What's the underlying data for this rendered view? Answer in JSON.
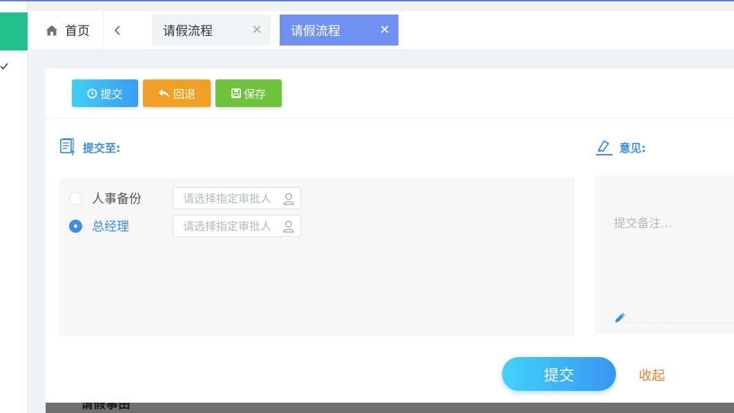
{
  "colors": {
    "accent": "#3a8ee6",
    "brand_green": "#22c08a",
    "active_tab": "#6f91ef",
    "btn_back": "#f0a126",
    "btn_save": "#6dc33c",
    "collapse_text": "#e8802f"
  },
  "tabs_bar": {
    "home_label": "首页",
    "tabs": [
      {
        "label": "请假流程",
        "active": false
      },
      {
        "label": "请假流程",
        "active": true
      }
    ]
  },
  "toolbar": {
    "submit_label": "提交",
    "back_label": "回退",
    "save_label": "保存"
  },
  "submit_to": {
    "title": "提交至:",
    "options": [
      {
        "label": "人事备份",
        "checked": false,
        "placeholder": "请选择指定审批人"
      },
      {
        "label": "总经理",
        "checked": true,
        "placeholder": "请选择指定审批人"
      }
    ]
  },
  "opinion": {
    "title": "意见:",
    "placeholder": "提交备注..."
  },
  "footer": {
    "submit_label": "提交",
    "collapse_label": "收起"
  },
  "overlay": {
    "partial_text": "请假事由"
  }
}
